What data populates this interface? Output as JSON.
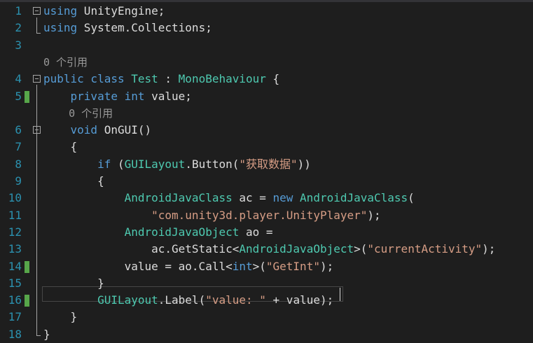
{
  "colors": {
    "background": "#1e1e1e",
    "line_number": "#2b91af",
    "keyword": "#569cd6",
    "type": "#4ec9b0",
    "string": "#d69d85",
    "plain": "#dcdcdc",
    "codelens": "#999999",
    "change_marker": "#57a64a"
  },
  "lines": [
    {
      "n": "1",
      "fold": "minus",
      "tokens": [
        {
          "t": "using",
          "c": "kw"
        },
        {
          "t": " UnityEngine;",
          "c": "pl"
        }
      ]
    },
    {
      "n": "2",
      "tokens": [
        {
          "t": "using",
          "c": "kw"
        },
        {
          "t": " System.Collections;",
          "c": "pl"
        }
      ]
    },
    {
      "n": "3",
      "tokens": []
    },
    {
      "lens": "0 个引用"
    },
    {
      "n": "4",
      "fold": "minus",
      "tokens": [
        {
          "t": "public class ",
          "c": "kw"
        },
        {
          "t": "Test",
          "c": "ty"
        },
        {
          "t": " : ",
          "c": "pl"
        },
        {
          "t": "MonoBehaviour",
          "c": "ty"
        },
        {
          "t": " {",
          "c": "pl"
        }
      ]
    },
    {
      "n": "5",
      "mark": true,
      "tokens": [
        {
          "t": "    private int ",
          "c": "kw"
        },
        {
          "t": "value;",
          "c": "pl"
        }
      ]
    },
    {
      "lens": "    0 个引用"
    },
    {
      "n": "6",
      "fold": "minus",
      "tokens": [
        {
          "t": "    void ",
          "c": "kw"
        },
        {
          "t": "OnGUI()",
          "c": "pl"
        }
      ]
    },
    {
      "n": "7",
      "tokens": [
        {
          "t": "    {",
          "c": "pl"
        }
      ]
    },
    {
      "n": "8",
      "tokens": [
        {
          "t": "        if ",
          "c": "kw"
        },
        {
          "t": "(",
          "c": "pl"
        },
        {
          "t": "GUILayout",
          "c": "ty"
        },
        {
          "t": ".Button(",
          "c": "pl"
        },
        {
          "t": "\"获取数据\"",
          "c": "st"
        },
        {
          "t": "))",
          "c": "pl"
        }
      ]
    },
    {
      "n": "9",
      "tokens": [
        {
          "t": "        {",
          "c": "pl"
        }
      ]
    },
    {
      "n": "10",
      "tokens": [
        {
          "t": "            ",
          "c": "pl"
        },
        {
          "t": "AndroidJavaClass",
          "c": "ty"
        },
        {
          "t": " ac = ",
          "c": "pl"
        },
        {
          "t": "new ",
          "c": "kw"
        },
        {
          "t": "AndroidJavaClass",
          "c": "ty"
        },
        {
          "t": "(",
          "c": "pl"
        }
      ]
    },
    {
      "n": "11",
      "tokens": [
        {
          "t": "                ",
          "c": "pl"
        },
        {
          "t": "\"com.unity3d.player.UnityPlayer\"",
          "c": "st"
        },
        {
          "t": ");",
          "c": "pl"
        }
      ]
    },
    {
      "n": "12",
      "tokens": [
        {
          "t": "            ",
          "c": "pl"
        },
        {
          "t": "AndroidJavaObject",
          "c": "ty"
        },
        {
          "t": " ao =",
          "c": "pl"
        }
      ]
    },
    {
      "n": "13",
      "tokens": [
        {
          "t": "                ac.GetStatic<",
          "c": "pl"
        },
        {
          "t": "AndroidJavaObject",
          "c": "ty"
        },
        {
          "t": ">(",
          "c": "pl"
        },
        {
          "t": "\"currentActivity\"",
          "c": "st"
        },
        {
          "t": ");",
          "c": "pl"
        }
      ]
    },
    {
      "n": "14",
      "mark": true,
      "tokens": [
        {
          "t": "            value = ao.Call<",
          "c": "pl"
        },
        {
          "t": "int",
          "c": "kw"
        },
        {
          "t": ">(",
          "c": "pl"
        },
        {
          "t": "\"GetInt\"",
          "c": "st"
        },
        {
          "t": ");",
          "c": "pl"
        }
      ]
    },
    {
      "n": "15",
      "tokens": [
        {
          "t": "        }",
          "c": "pl"
        }
      ]
    },
    {
      "n": "16",
      "mark": true,
      "current": true,
      "tokens": [
        {
          "t": "        ",
          "c": "pl"
        },
        {
          "t": "GUILayout",
          "c": "ty"
        },
        {
          "t": ".Label(",
          "c": "pl"
        },
        {
          "t": "\"value: \"",
          "c": "st"
        },
        {
          "t": " + value);",
          "c": "pl"
        }
      ]
    },
    {
      "n": "17",
      "tokens": [
        {
          "t": "    }",
          "c": "pl"
        }
      ]
    },
    {
      "n": "18",
      "tokens": [
        {
          "t": "}",
          "c": "pl"
        }
      ]
    }
  ]
}
